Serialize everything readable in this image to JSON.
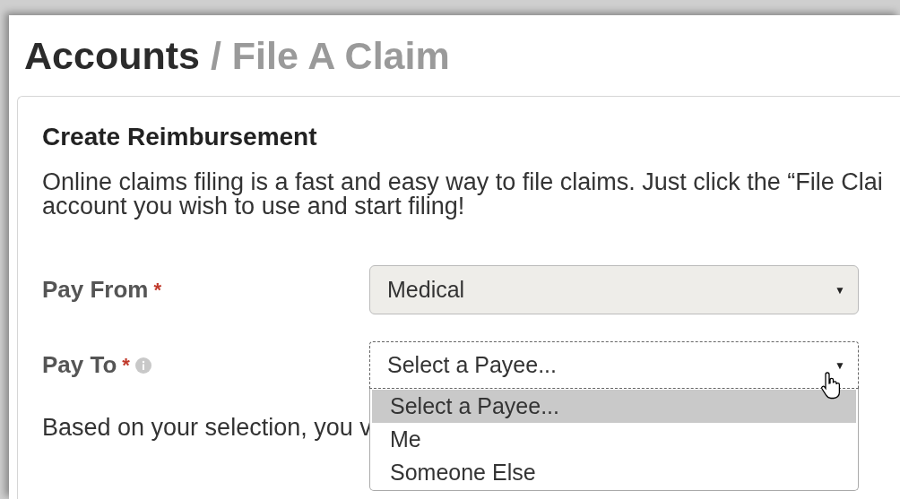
{
  "title": {
    "section": "Accounts",
    "page": "/ File A Claim"
  },
  "card": {
    "heading": "Create Reimbursement",
    "intro": [
      "Online claims filing is a fast and easy way to file claims. Just click the “File Clai",
      "account you wish to use and start filing!"
    ],
    "fields": [
      {
        "label": "Pay From",
        "required": "*",
        "value": "Medical",
        "caret": "▼",
        "focused": false
      },
      {
        "label": "Pay To",
        "required": "*",
        "info": true,
        "value": "Select a Payee...",
        "caret": "▼",
        "focused": true,
        "options": [
          {
            "label": "Select a Payee...",
            "selected": true
          },
          {
            "label": "Me",
            "selected": false
          },
          {
            "label": "Someone Else",
            "selected": false
          }
        ]
      }
    ],
    "note": "Based on your selection, you v"
  }
}
